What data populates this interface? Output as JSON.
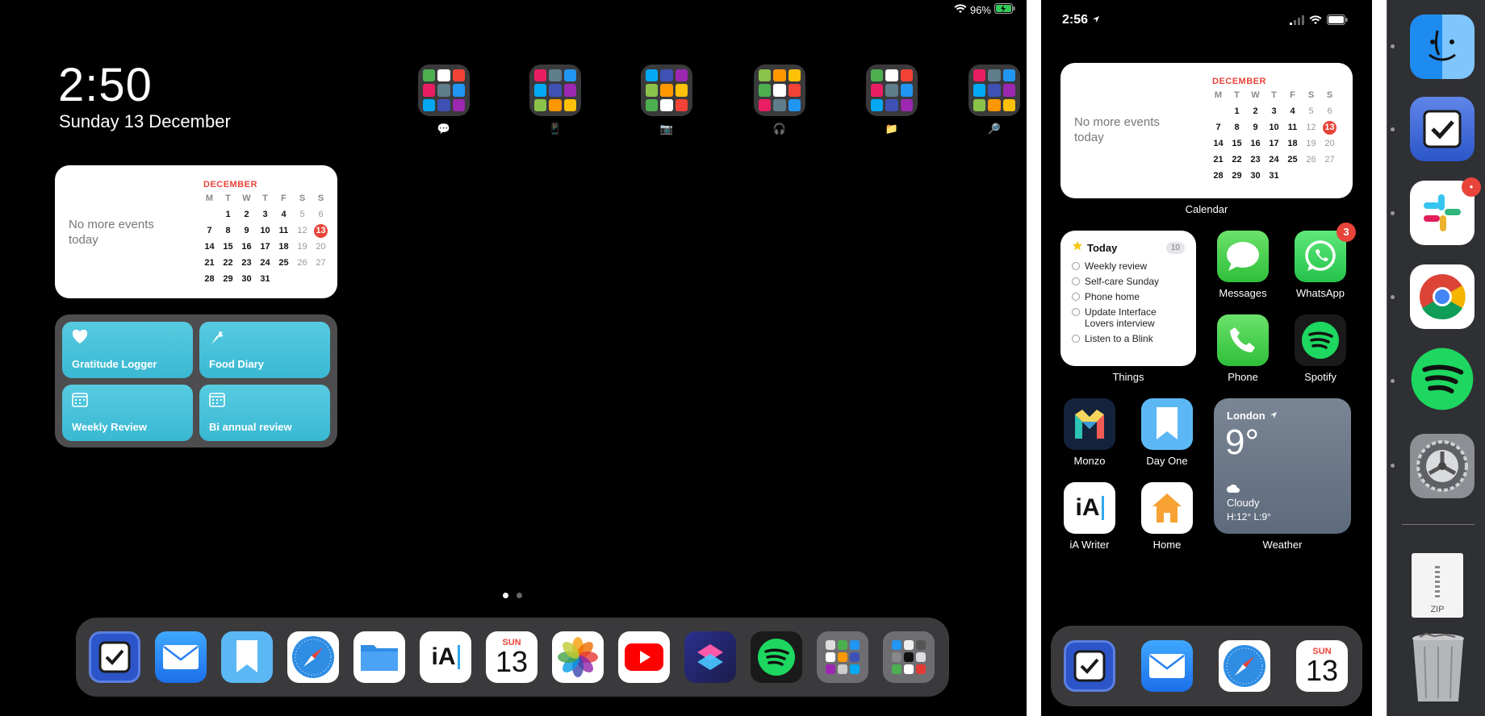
{
  "ipad": {
    "status": {
      "battery": "96%"
    },
    "lock": {
      "time": "2:50",
      "date": "Sunday 13 December"
    },
    "calendar_widget": {
      "no_events": "No more events today",
      "month": "DECEMBER",
      "weekdays": [
        "M",
        "T",
        "W",
        "T",
        "F",
        "S",
        "S"
      ],
      "weeks": [
        [
          "",
          "1",
          "2",
          "3",
          "4",
          "5",
          "6"
        ],
        [
          "7",
          "8",
          "9",
          "10",
          "11",
          "12",
          "13"
        ],
        [
          "14",
          "15",
          "16",
          "17",
          "18",
          "19",
          "20"
        ],
        [
          "21",
          "22",
          "23",
          "24",
          "25",
          "26",
          "27"
        ],
        [
          "28",
          "29",
          "30",
          "31",
          "",
          "",
          ""
        ]
      ],
      "today": "13"
    },
    "shortcuts": [
      {
        "label": "Gratitude Logger",
        "icon": "heart-icon"
      },
      {
        "label": "Food Diary",
        "icon": "carrot-icon"
      },
      {
        "label": "Weekly Review",
        "icon": "calendar-grid-icon"
      },
      {
        "label": "Bi annual review",
        "icon": "calendar-grid-icon"
      }
    ],
    "folders": [
      {
        "label": "💬",
        "name": "folder-chat"
      },
      {
        "label": "📱",
        "name": "folder-phone"
      },
      {
        "label": "📷",
        "name": "folder-camera"
      },
      {
        "label": "🎧",
        "name": "folder-headphones"
      },
      {
        "label": "📁",
        "name": "folder-files"
      },
      {
        "label": "🔎",
        "name": "folder-search"
      }
    ],
    "dock_apps": [
      "Things",
      "Mail",
      "Day One",
      "Safari",
      "Files",
      "iA Writer",
      "Calendar",
      "Photos",
      "YouTube",
      "Shortcuts",
      "Spotify",
      "Folder A",
      "Folder B"
    ],
    "calendar_icon": {
      "day": "SUN",
      "date": "13"
    }
  },
  "iphone": {
    "status": {
      "time": "2:56"
    },
    "calendar_widget": {
      "no_events": "No more events today",
      "month": "DECEMBER",
      "label": "Calendar"
    },
    "things_widget": {
      "title": "Today",
      "count": "10",
      "items": [
        "Weekly review",
        "Self-care Sunday",
        "Phone home",
        "Update Interface Lovers interview",
        "Listen to a Blink"
      ],
      "label": "Things"
    },
    "apps": {
      "messages": "Messages",
      "whatsapp": "WhatsApp",
      "whatsapp_badge": "3",
      "phone": "Phone",
      "spotify": "Spotify",
      "monzo": "Monzo",
      "dayone": "Day One",
      "iawriter": "iA Writer",
      "home": "Home"
    },
    "weather": {
      "city": "London",
      "temp": "9°",
      "condition": "Cloudy",
      "hilo": "H:12° L:9°",
      "label": "Weather"
    },
    "calendar_icon": {
      "day": "SUN",
      "date": "13"
    }
  },
  "mac_dock": {
    "zip_label": "ZIP"
  },
  "colors": {
    "accent_red": "#e8443a",
    "shortcut_teal": "#45c0d8",
    "spotify_green": "#1ed760"
  }
}
